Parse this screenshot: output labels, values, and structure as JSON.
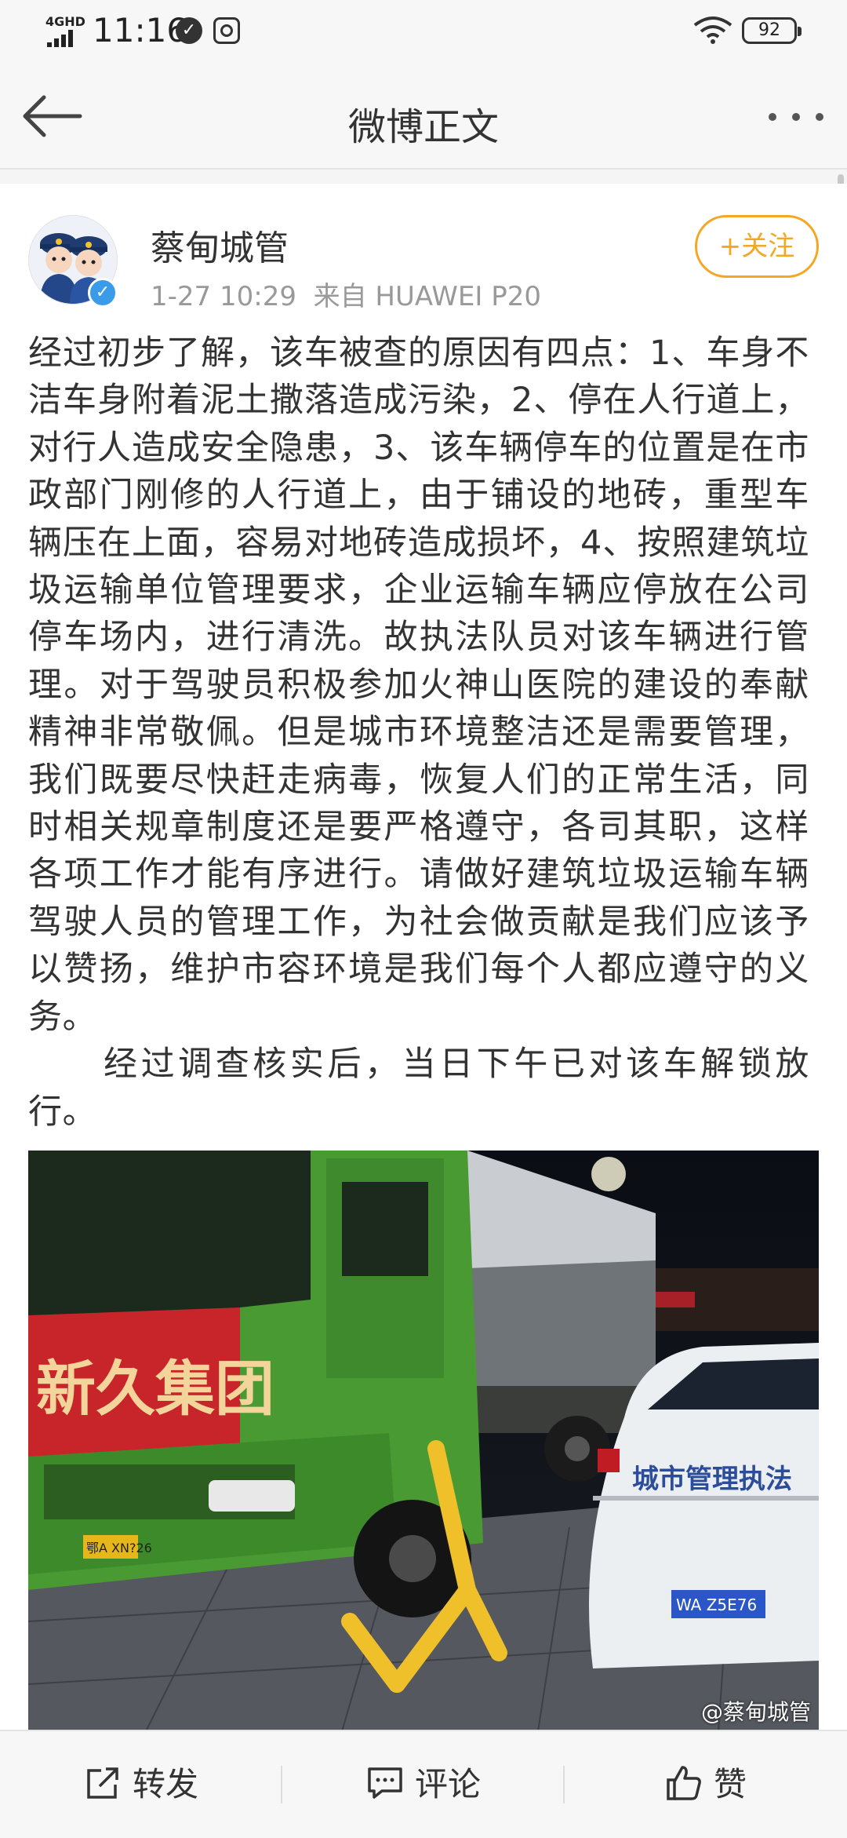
{
  "status_bar": {
    "network": "4GHD",
    "time": "11:16",
    "battery": "92"
  },
  "nav": {
    "title": "微博正文"
  },
  "post": {
    "author": "蔡甸城管",
    "timestamp": "1-27 10:29",
    "source": "来自 HUAWEI P20",
    "follow_label": "+关注",
    "paragraph_1": "经过初步了解，该车被查的原因有四点：1、车身不洁车身附着泥土撒落造成污染，2、停在人行道上，对行人造成安全隐患，3、该车辆停车的位置是在市政部门刚修的人行道上，由于铺设的地砖，重型车辆压在上面，容易对地砖造成损坏，4、按照建筑垃圾运输单位管理要求，企业运输车辆应停放在公司停车场内，进行清洗。故执法队员对该车辆进行管理。对于驾驶员积极参加火神山医院的建设的奉献精神非常敬佩。但是城市环境整洁还是需要管理，我们既要尽快赶走病毒，恢复人们的正常生活，同时相关规章制度还是要严格遵守，各司其职，这样各项工作才能有序进行。请做好建筑垃圾运输车辆驾驶人员的管理工作，为社会做贡献是我们应该予以赞扬，维护市容环境是我们每个人都应遵守的义务。",
    "paragraph_2": "经过调查核实后，当日下午已对该车解锁放行。",
    "photo": {
      "banner_text": "新久集团",
      "car_text": "城市管理执法",
      "truck_plate": "鄂A XN?26",
      "car_plate": "WA Z5E76",
      "watermark": "@蔡甸城管"
    }
  },
  "toolbar": {
    "repost_label": "转发",
    "comment_label": "评论",
    "like_label": "赞"
  }
}
